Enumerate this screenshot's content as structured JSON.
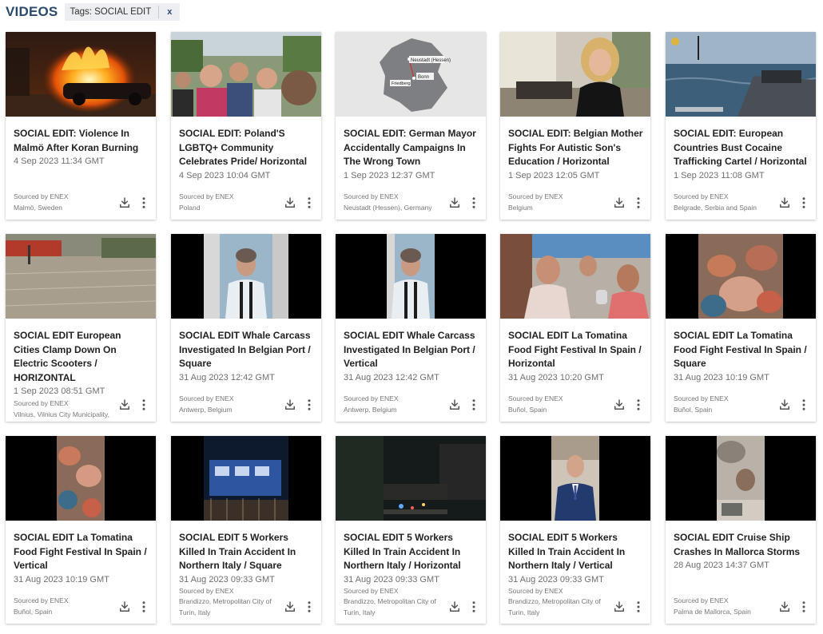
{
  "header": {
    "title": "VIDEOS",
    "tag_chip": "Tags: SOCIAL EDIT",
    "tag_close": "x"
  },
  "source_label": "Sourced by ENEX",
  "icons": {
    "download": "download-icon",
    "more": "more-vertical-icon"
  },
  "videos": [
    {
      "title": "SOCIAL EDIT: Violence In Malmö After Koran Burning",
      "date": "4 Sep 2023 11:34 GMT",
      "source": "Sourced by ENEX",
      "location": "Malmö, Sweden"
    },
    {
      "title": "SOCIAL EDIT: Poland'S LGBTQ+ Community Celebrates Pride/ Horizontal",
      "date": "4 Sep 2023 10:04 GMT",
      "source": "Sourced by ENEX",
      "location": "Poland"
    },
    {
      "title": "SOCIAL EDIT: German Mayor Accidentally Campaigns In The Wrong Town",
      "date": "1 Sep 2023 12:37 GMT",
      "source": "Sourced by ENEX",
      "location": "Neustadt (Hessen), Germany",
      "map_labels": [
        "Neustadt (Hessen)",
        "Bonn",
        "Friedberg"
      ]
    },
    {
      "title": "SOCIAL EDIT: Belgian Mother Fights For Autistic Son's Education / Horizontal",
      "date": "1 Sep 2023 12:05 GMT",
      "source": "Sourced by ENEX",
      "location": "Belgium"
    },
    {
      "title": "SOCIAL EDIT: European Countries Bust Cocaine Trafficking Cartel / Horizontal",
      "date": "1 Sep 2023 11:08 GMT",
      "source": "Sourced by ENEX",
      "location": "Belgrade, Serbia and Spain"
    },
    {
      "title": "SOCIAL EDIT European Cities Clamp Down On Electric Scooters / HORIZONTAL",
      "date": "1 Sep 2023 08:51 GMT",
      "source": "Sourced by ENEX",
      "location": "Vilnius, Vilnius City Municipality, Lithuania and Paris, France"
    },
    {
      "title": "SOCIAL EDIT Whale Carcass Investigated In Belgian Port / Square",
      "date": "31 Aug 2023 12:42 GMT",
      "source": "Sourced by ENEX",
      "location": "Antwerp, Belgium"
    },
    {
      "title": "SOCIAL EDIT Whale Carcass Investigated In Belgian Port / Vertical",
      "date": "31 Aug 2023 12:42 GMT",
      "source": "Sourced by ENEX",
      "location": "Antwerp, Belgium"
    },
    {
      "title": "SOCIAL EDIT La Tomatina Food Fight Festival In Spain / Horizontal",
      "date": "31 Aug 2023 10:20 GMT",
      "source": "Sourced by ENEX",
      "location": "Buñol, Spain"
    },
    {
      "title": "SOCIAL EDIT La Tomatina Food Fight Festival In Spain / Square",
      "date": "31 Aug 2023 10:19 GMT",
      "source": "Sourced by ENEX",
      "location": "Buñol, Spain"
    },
    {
      "title": "SOCIAL EDIT La Tomatina Food Fight Festival In Spain / Vertical",
      "date": "31 Aug 2023 10:19 GMT",
      "source": "Sourced by ENEX",
      "location": "Buñol, Spain"
    },
    {
      "title": "SOCIAL EDIT 5 Workers Killed In Train Accident In Northern Italy / Square",
      "date": "31 Aug 2023 09:33 GMT",
      "source": "Sourced by ENEX",
      "location": "Brandizzo, Metropolitan City of Turin, Italy"
    },
    {
      "title": "SOCIAL EDIT 5 Workers Killed In Train Accident In Northern Italy / Horizontal",
      "date": "31 Aug 2023 09:33 GMT",
      "source": "Sourced by ENEX",
      "location": "Brandizzo, Metropolitan City of Turin, Italy"
    },
    {
      "title": "SOCIAL EDIT 5 Workers Killed In Train Accident In Northern Italy / Vertical",
      "date": "31 Aug 2023 09:33 GMT",
      "source": "Sourced by ENEX",
      "location": "Brandizzo, Metropolitan City of Turin, Italy"
    },
    {
      "title": "SOCIAL EDIT Cruise Ship Crashes In Mallorca Storms",
      "date": "28 Aug 2023 14:37 GMT",
      "source": "Sourced by ENEX",
      "location": "Palma de Mallorca, Spain"
    }
  ]
}
